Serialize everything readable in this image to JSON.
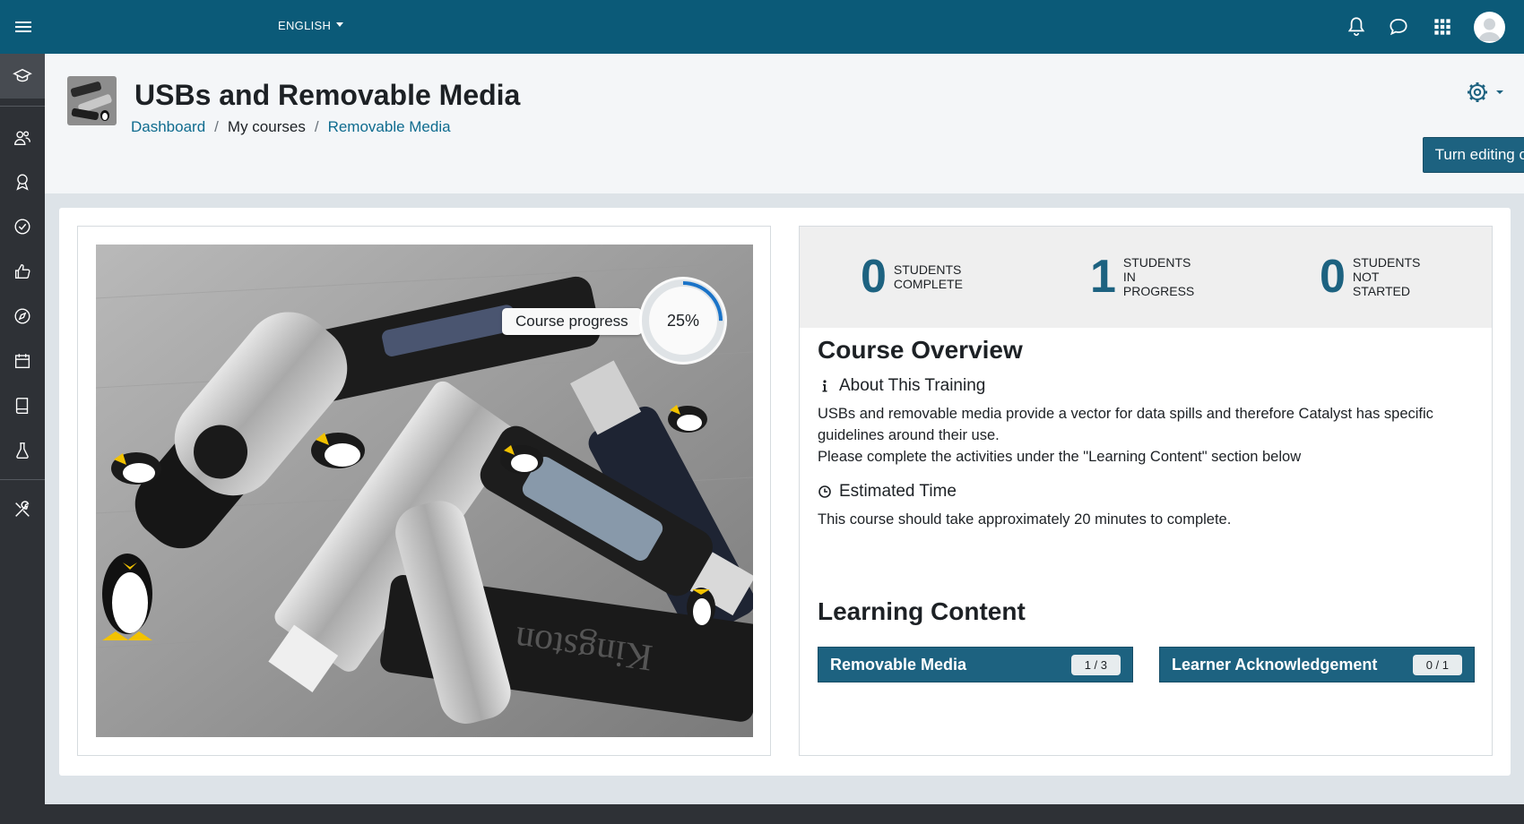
{
  "navbar": {
    "language": "ENGLISH",
    "icons": [
      "menu-icon",
      "bell-icon",
      "chat-icon",
      "apps-grid-icon",
      "user-avatar"
    ]
  },
  "rail": {
    "items": [
      "graduation-cap-icon",
      "users-icon",
      "badge-icon",
      "check-circle-icon",
      "thumbs-up-icon",
      "compass-icon",
      "calendar-icon",
      "book-icon",
      "flask-icon",
      "tools-icon"
    ]
  },
  "header": {
    "title": "USBs and Removable Media",
    "breadcrumb": {
      "dashboard": "Dashboard",
      "sep1": "/",
      "my_courses": "My courses",
      "sep2": "/",
      "current": "Removable Media"
    },
    "edit_button": "Turn editing on"
  },
  "progress": {
    "label": "Course progress",
    "percent_text": "25%",
    "value": 0.25,
    "accent": "#1a73c8"
  },
  "stats": {
    "complete": {
      "count": "0",
      "label_1": "STUDENTS",
      "label_2": "COMPLETE"
    },
    "in_progress": {
      "count": "1",
      "label_1": "STUDENTS",
      "label_2": "IN",
      "label_3": "PROGRESS"
    },
    "not_started": {
      "count": "0",
      "label_1": "STUDENTS",
      "label_2": "NOT",
      "label_3": "STARTED"
    }
  },
  "overview": {
    "title": "Course Overview",
    "about_heading": "About This Training",
    "about_text_1": "USBs and removable media provide a vector for data spills and therefore Catalyst has specific guidelines around their use.",
    "about_text_2": "Please complete the activities under the \"Learning Content\" section below",
    "time_heading": "Estimated Time",
    "time_text": "This course should take approximately 20 minutes to complete."
  },
  "learning": {
    "title": "Learning Content",
    "items": [
      {
        "label": "Removable Media",
        "badge": "1 / 3"
      },
      {
        "label": "Learner Acknowledgement",
        "badge": "0 / 1"
      }
    ]
  },
  "colors": {
    "navbar": "#0b5a78",
    "rail": "#2e3136",
    "primary_button": "#1d6280",
    "stat_number": "#1d6280"
  }
}
